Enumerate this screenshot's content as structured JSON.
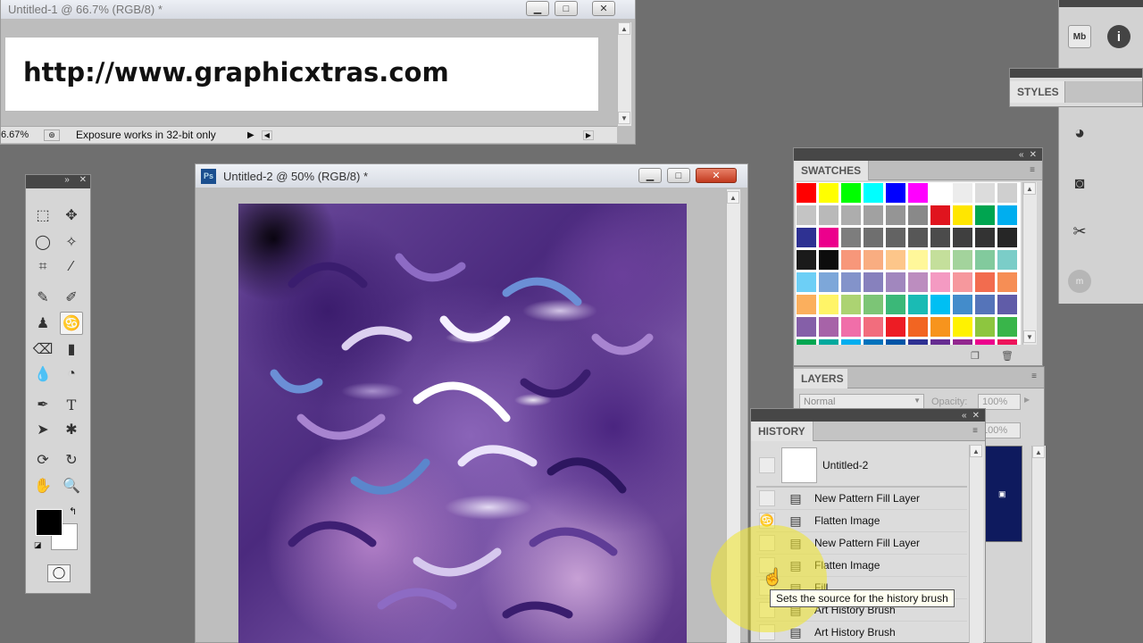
{
  "doc1": {
    "title": "Untitled-1 @ 66.7% (RGB/8) *",
    "content_text": "http://www.graphicxtras.com",
    "zoom": "6.67%",
    "status": "Exposure works in 32-bit only"
  },
  "doc2": {
    "title": "Untitled-2 @ 50% (RGB/8) *",
    "ps_logo": "Ps"
  },
  "swatches": {
    "title": "SWATCHES",
    "rows": [
      [
        "#ff0000",
        "#ffff00",
        "#00ff00",
        "#00ffff",
        "#0000ff",
        "#ff00ff",
        "#ffffff",
        "#ececec",
        "#dcdcdc",
        "#cfcfcf"
      ],
      [
        "#c4c4c4",
        "#b9b9b9",
        "#adadad",
        "#a1a1a1",
        "#959595",
        "#898989",
        "#e0141e",
        "#ffe600",
        "#00a550",
        "#00aeef"
      ],
      [
        "#2e3192",
        "#ec008c",
        "#7d7d7d",
        "#6f6f6f",
        "#636363",
        "#575757",
        "#4b4b4b",
        "#3f3f3f",
        "#333333",
        "#262626"
      ],
      [
        "#1a1a1a",
        "#0d0d0d",
        "#f7977a",
        "#f9ad81",
        "#fdc68a",
        "#fff79a",
        "#c4df9b",
        "#a3d39c",
        "#82ca9d",
        "#7bcdc8"
      ],
      [
        "#6dcff6",
        "#7da7d9",
        "#8393ca",
        "#8781bd",
        "#a187be",
        "#bc8dbf",
        "#f49ac2",
        "#f6989d",
        "#f26c4f",
        "#f68e55"
      ],
      [
        "#fbaf5d",
        "#fff467",
        "#acd372",
        "#7cc576",
        "#3bb878",
        "#1abbb4",
        "#00bff3",
        "#438ccb",
        "#5574b9",
        "#605ca8"
      ],
      [
        "#855fa8",
        "#a763a8",
        "#f06ea9",
        "#f26d7d",
        "#ed1c24",
        "#f26522",
        "#f7941d",
        "#fff200",
        "#8dc63f",
        "#39b54a"
      ],
      [
        "#00a651",
        "#00a99d",
        "#00aeef",
        "#0072bc",
        "#0054a6",
        "#2e3192",
        "#662d91",
        "#92278f",
        "#ec008c",
        "#ed145b"
      ]
    ]
  },
  "layers": {
    "title": "LAYERS",
    "blend_mode": "Normal",
    "opacity_label": "Opacity:",
    "opacity_value": "100%",
    "fill_value": "100%"
  },
  "history": {
    "title": "HISTORY",
    "snapshot_label": "Untitled-2",
    "items": [
      {
        "label": "New Pattern Fill Layer",
        "checked": false
      },
      {
        "label": "Flatten Image",
        "checked": true
      },
      {
        "label": "New Pattern Fill Layer",
        "checked": false
      },
      {
        "label": "Flatten Image",
        "checked": false
      },
      {
        "label": "Fill",
        "checked": false
      },
      {
        "label": "Art History Brush",
        "checked": false
      },
      {
        "label": "Art History Brush",
        "checked": false
      }
    ],
    "tooltip": "Sets the source for the history brush"
  },
  "styles": {
    "title": "STYLES"
  },
  "toolbar": {
    "tools": [
      "rect-marquee",
      "move",
      "lasso",
      "quick-select",
      "crop",
      "eyedropper",
      "healing-brush",
      "brush",
      "clone-stamp",
      "history-brush",
      "eraser",
      "gradient",
      "blur",
      "dodge",
      "pen",
      "type",
      "path-select",
      "shape",
      "3d-rotate",
      "3d-orbit",
      "hand",
      "zoom"
    ],
    "fg_color": "#000000",
    "bg_color": "#ffffff"
  },
  "dock": {
    "icons": [
      "mini-bridge-icon",
      "info-icon",
      "styles-icon",
      "camera-icon",
      "tools-icon",
      "mask-icon"
    ]
  }
}
